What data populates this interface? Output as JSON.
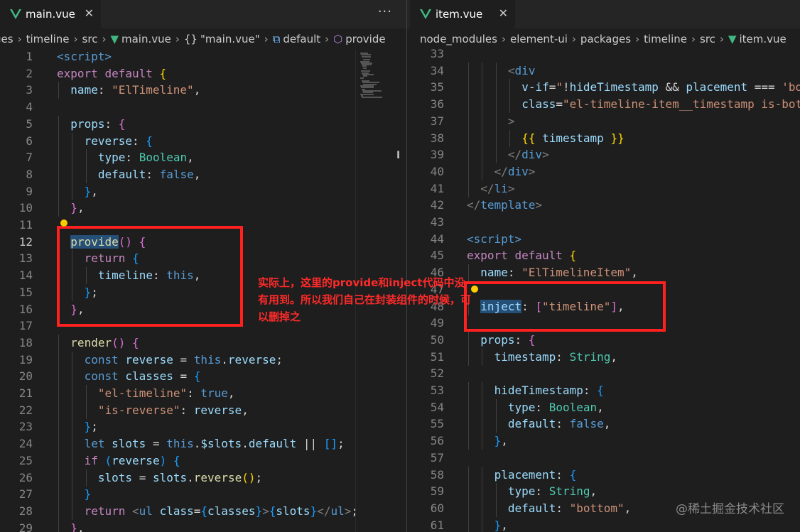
{
  "left": {
    "tab": {
      "title": "main.vue",
      "close": "✕"
    },
    "more": "···",
    "breadcrumb": [
      {
        "text": "ges",
        "icon": ""
      },
      {
        "text": "timeline",
        "icon": ""
      },
      {
        "text": "src",
        "icon": ""
      },
      {
        "text": "main.vue",
        "icon": "vue-icon"
      },
      {
        "text": "\"main.vue\"",
        "icon": "braces-icon"
      },
      {
        "text": "default",
        "icon": "module-icon"
      },
      {
        "text": "provide",
        "icon": "cube-icon"
      }
    ],
    "active_line": 12,
    "lines": [
      {
        "n": 1,
        "indent": 0,
        "tokens": [
          [
            "tag",
            "<script>"
          ]
        ]
      },
      {
        "n": 2,
        "indent": 0,
        "tokens": [
          [
            "ctl",
            "export"
          ],
          [
            "plain",
            " "
          ],
          [
            "ctl",
            "default"
          ],
          [
            "plain",
            " "
          ],
          [
            "b1",
            "{"
          ]
        ]
      },
      {
        "n": 3,
        "indent": 1,
        "tokens": [
          [
            "p",
            "name"
          ],
          [
            "plain",
            ": "
          ],
          [
            "s",
            "\"ElTimeline\""
          ],
          [
            "plain",
            ","
          ]
        ]
      },
      {
        "n": 4,
        "indent": 0,
        "tokens": []
      },
      {
        "n": 5,
        "indent": 1,
        "tokens": [
          [
            "p",
            "props"
          ],
          [
            "plain",
            ": "
          ],
          [
            "b2",
            "{"
          ]
        ]
      },
      {
        "n": 6,
        "indent": 2,
        "tokens": [
          [
            "p",
            "reverse"
          ],
          [
            "plain",
            ": "
          ],
          [
            "b3",
            "{"
          ]
        ]
      },
      {
        "n": 7,
        "indent": 3,
        "tokens": [
          [
            "p",
            "type"
          ],
          [
            "plain",
            ": "
          ],
          [
            "t",
            "Boolean"
          ],
          [
            "plain",
            ","
          ]
        ]
      },
      {
        "n": 8,
        "indent": 3,
        "tokens": [
          [
            "p",
            "default"
          ],
          [
            "plain",
            ": "
          ],
          [
            "k",
            "false"
          ],
          [
            "plain",
            ","
          ]
        ]
      },
      {
        "n": 9,
        "indent": 2,
        "tokens": [
          [
            "b3",
            "}"
          ],
          [
            "plain",
            ","
          ]
        ]
      },
      {
        "n": 10,
        "indent": 1,
        "tokens": [
          [
            "b2",
            "}"
          ],
          [
            "plain",
            ","
          ]
        ]
      },
      {
        "n": 11,
        "indent": 0,
        "tokens": []
      },
      {
        "n": 12,
        "indent": 1,
        "tokens": [
          [
            "f hl",
            "provide"
          ],
          [
            "b2",
            "()"
          ],
          [
            "plain",
            " "
          ],
          [
            "b2",
            "{"
          ]
        ]
      },
      {
        "n": 13,
        "indent": 2,
        "tokens": [
          [
            "ctl",
            "return"
          ],
          [
            "plain",
            " "
          ],
          [
            "b3",
            "{"
          ]
        ]
      },
      {
        "n": 14,
        "indent": 3,
        "tokens": [
          [
            "p",
            "timeline"
          ],
          [
            "plain",
            ": "
          ],
          [
            "k",
            "this"
          ],
          [
            "plain",
            ","
          ]
        ]
      },
      {
        "n": 15,
        "indent": 2,
        "tokens": [
          [
            "b3",
            "}"
          ],
          [
            "plain",
            ";"
          ]
        ]
      },
      {
        "n": 16,
        "indent": 1,
        "tokens": [
          [
            "b2",
            "}"
          ],
          [
            "plain",
            ","
          ]
        ]
      },
      {
        "n": 17,
        "indent": 0,
        "tokens": []
      },
      {
        "n": 18,
        "indent": 1,
        "tokens": [
          [
            "f",
            "render"
          ],
          [
            "b2",
            "()"
          ],
          [
            "plain",
            " "
          ],
          [
            "b2",
            "{"
          ]
        ]
      },
      {
        "n": 19,
        "indent": 2,
        "tokens": [
          [
            "k",
            "const"
          ],
          [
            "plain",
            " "
          ],
          [
            "p",
            "reverse"
          ],
          [
            "plain",
            " = "
          ],
          [
            "k",
            "this"
          ],
          [
            "plain",
            "."
          ],
          [
            "p",
            "reverse"
          ],
          [
            "plain",
            ";"
          ]
        ]
      },
      {
        "n": 20,
        "indent": 2,
        "tokens": [
          [
            "k",
            "const"
          ],
          [
            "plain",
            " "
          ],
          [
            "p",
            "classes"
          ],
          [
            "plain",
            " = "
          ],
          [
            "b3",
            "{"
          ]
        ]
      },
      {
        "n": 21,
        "indent": 3,
        "tokens": [
          [
            "s",
            "\"el-timeline\""
          ],
          [
            "plain",
            ": "
          ],
          [
            "k",
            "true"
          ],
          [
            "plain",
            ","
          ]
        ]
      },
      {
        "n": 22,
        "indent": 3,
        "tokens": [
          [
            "s",
            "\"is-reverse\""
          ],
          [
            "plain",
            ": "
          ],
          [
            "p",
            "reverse"
          ],
          [
            "plain",
            ","
          ]
        ]
      },
      {
        "n": 23,
        "indent": 2,
        "tokens": [
          [
            "b3",
            "}"
          ],
          [
            "plain",
            ";"
          ]
        ]
      },
      {
        "n": 24,
        "indent": 2,
        "tokens": [
          [
            "k",
            "let"
          ],
          [
            "plain",
            " "
          ],
          [
            "p",
            "slots"
          ],
          [
            "plain",
            " = "
          ],
          [
            "k",
            "this"
          ],
          [
            "plain",
            "."
          ],
          [
            "p",
            "$slots"
          ],
          [
            "plain",
            "."
          ],
          [
            "p",
            "default"
          ],
          [
            "plain",
            " || "
          ],
          [
            "b3",
            "[]"
          ],
          [
            "plain",
            ";"
          ]
        ]
      },
      {
        "n": 25,
        "indent": 2,
        "tokens": [
          [
            "ctl",
            "if"
          ],
          [
            "plain",
            " "
          ],
          [
            "b3",
            "("
          ],
          [
            "p",
            "reverse"
          ],
          [
            "b3",
            ")"
          ],
          [
            "plain",
            " "
          ],
          [
            "b3",
            "{"
          ]
        ]
      },
      {
        "n": 26,
        "indent": 3,
        "tokens": [
          [
            "p",
            "slots"
          ],
          [
            "plain",
            " = "
          ],
          [
            "p",
            "slots"
          ],
          [
            "plain",
            "."
          ],
          [
            "f",
            "reverse"
          ],
          [
            "b1",
            "()"
          ],
          [
            "plain",
            ";"
          ]
        ]
      },
      {
        "n": 27,
        "indent": 2,
        "tokens": [
          [
            "b3",
            "}"
          ]
        ]
      },
      {
        "n": 28,
        "indent": 2,
        "tokens": [
          [
            "ctl",
            "return"
          ],
          [
            "plain",
            " "
          ],
          [
            "gray",
            "<"
          ],
          [
            "tag",
            "ul"
          ],
          [
            "plain",
            " "
          ],
          [
            "p",
            "class"
          ],
          [
            "plain",
            "="
          ],
          [
            "b3",
            "{"
          ],
          [
            "p",
            "classes"
          ],
          [
            "b3",
            "}"
          ],
          [
            "gray",
            ">"
          ],
          [
            "b3",
            "{"
          ],
          [
            "p",
            "slots"
          ],
          [
            "b3",
            "}"
          ],
          [
            "gray",
            "</"
          ],
          [
            "tag",
            "ul"
          ],
          [
            "gray",
            ">"
          ],
          [
            "plain",
            ";"
          ]
        ]
      },
      {
        "n": 29,
        "indent": 1,
        "tokens": [
          [
            "b2",
            "}"
          ],
          [
            "plain",
            ","
          ]
        ]
      }
    ]
  },
  "right": {
    "tab": {
      "title": "item.vue",
      "close": "✕"
    },
    "breadcrumb": [
      {
        "text": "node_modules",
        "icon": ""
      },
      {
        "text": "element-ui",
        "icon": ""
      },
      {
        "text": "packages",
        "icon": ""
      },
      {
        "text": "timeline",
        "icon": ""
      },
      {
        "text": "src",
        "icon": ""
      },
      {
        "text": "item.vue",
        "icon": "vue-icon"
      }
    ],
    "lines": [
      {
        "n": 33,
        "indent": 0,
        "tokens": []
      },
      {
        "n": 34,
        "indent": 3,
        "tokens": [
          [
            "gray",
            "<"
          ],
          [
            "tag",
            "div"
          ]
        ]
      },
      {
        "n": 35,
        "indent": 4,
        "tokens": [
          [
            "p",
            "v-if"
          ],
          [
            "plain",
            "="
          ],
          [
            "s",
            "\""
          ],
          [
            "plain",
            "!"
          ],
          [
            "p",
            "hideTimestamp"
          ],
          [
            "plain",
            " && "
          ],
          [
            "p",
            "placement"
          ],
          [
            "plain",
            " === "
          ],
          [
            "s",
            "'bottom'\""
          ]
        ]
      },
      {
        "n": 36,
        "indent": 4,
        "tokens": [
          [
            "p",
            "class"
          ],
          [
            "plain",
            "="
          ],
          [
            "s",
            "\"el-timeline-item__timestamp is-bottom\""
          ]
        ]
      },
      {
        "n": 37,
        "indent": 3,
        "tokens": [
          [
            "gray",
            ">"
          ]
        ]
      },
      {
        "n": 38,
        "indent": 4,
        "tokens": [
          [
            "b1",
            "{{"
          ],
          [
            "plain",
            " "
          ],
          [
            "p",
            "timestamp"
          ],
          [
            "plain",
            " "
          ],
          [
            "b1",
            "}}"
          ]
        ]
      },
      {
        "n": 39,
        "indent": 3,
        "tokens": [
          [
            "gray",
            "</"
          ],
          [
            "tag",
            "div"
          ],
          [
            "gray",
            ">"
          ]
        ]
      },
      {
        "n": 40,
        "indent": 2,
        "tokens": [
          [
            "gray",
            "</"
          ],
          [
            "tag",
            "div"
          ],
          [
            "gray",
            ">"
          ]
        ]
      },
      {
        "n": 41,
        "indent": 1,
        "tokens": [
          [
            "gray",
            "</"
          ],
          [
            "tag",
            "li"
          ],
          [
            "gray",
            ">"
          ]
        ]
      },
      {
        "n": 42,
        "indent": 0,
        "tokens": [
          [
            "gray",
            "</"
          ],
          [
            "tag",
            "template"
          ],
          [
            "gray",
            ">"
          ]
        ]
      },
      {
        "n": 43,
        "indent": 0,
        "tokens": []
      },
      {
        "n": 44,
        "indent": 0,
        "tokens": [
          [
            "tag",
            "<script>"
          ]
        ]
      },
      {
        "n": 45,
        "indent": 0,
        "tokens": [
          [
            "ctl",
            "export"
          ],
          [
            "plain",
            " "
          ],
          [
            "ctl",
            "default"
          ],
          [
            "plain",
            " "
          ],
          [
            "b1",
            "{"
          ]
        ]
      },
      {
        "n": 46,
        "indent": 1,
        "tokens": [
          [
            "p",
            "name"
          ],
          [
            "plain",
            ": "
          ],
          [
            "s",
            "\"ElTimelineItem\""
          ],
          [
            "plain",
            ","
          ]
        ]
      },
      {
        "n": 47,
        "indent": 0,
        "tokens": []
      },
      {
        "n": 48,
        "indent": 1,
        "tokens": [
          [
            "p hl",
            "inject"
          ],
          [
            "plain",
            ": "
          ],
          [
            "b2",
            "["
          ],
          [
            "s",
            "\"timeline\""
          ],
          [
            "b2",
            "]"
          ],
          [
            "plain",
            ","
          ]
        ]
      },
      {
        "n": 49,
        "indent": 0,
        "tokens": []
      },
      {
        "n": 50,
        "indent": 1,
        "tokens": [
          [
            "p",
            "props"
          ],
          [
            "plain",
            ": "
          ],
          [
            "b2",
            "{"
          ]
        ]
      },
      {
        "n": 51,
        "indent": 2,
        "tokens": [
          [
            "p",
            "timestamp"
          ],
          [
            "plain",
            ": "
          ],
          [
            "t",
            "String"
          ],
          [
            "plain",
            ","
          ]
        ]
      },
      {
        "n": 52,
        "indent": 0,
        "tokens": []
      },
      {
        "n": 53,
        "indent": 2,
        "tokens": [
          [
            "p",
            "hideTimestamp"
          ],
          [
            "plain",
            ": "
          ],
          [
            "b3",
            "{"
          ]
        ]
      },
      {
        "n": 54,
        "indent": 3,
        "tokens": [
          [
            "p",
            "type"
          ],
          [
            "plain",
            ": "
          ],
          [
            "t",
            "Boolean"
          ],
          [
            "plain",
            ","
          ]
        ]
      },
      {
        "n": 55,
        "indent": 3,
        "tokens": [
          [
            "p",
            "default"
          ],
          [
            "plain",
            ": "
          ],
          [
            "k",
            "false"
          ],
          [
            "plain",
            ","
          ]
        ]
      },
      {
        "n": 56,
        "indent": 2,
        "tokens": [
          [
            "b3",
            "}"
          ],
          [
            "plain",
            ","
          ]
        ]
      },
      {
        "n": 57,
        "indent": 0,
        "tokens": []
      },
      {
        "n": 58,
        "indent": 2,
        "tokens": [
          [
            "p",
            "placement"
          ],
          [
            "plain",
            ": "
          ],
          [
            "b3",
            "{"
          ]
        ]
      },
      {
        "n": 59,
        "indent": 3,
        "tokens": [
          [
            "p",
            "type"
          ],
          [
            "plain",
            ": "
          ],
          [
            "t",
            "String"
          ],
          [
            "plain",
            ","
          ]
        ]
      },
      {
        "n": 60,
        "indent": 3,
        "tokens": [
          [
            "p",
            "default"
          ],
          [
            "plain",
            ": "
          ],
          [
            "s",
            "\"bottom\""
          ],
          [
            "plain",
            ","
          ]
        ]
      },
      {
        "n": 61,
        "indent": 2,
        "tokens": [
          [
            "b3",
            "}"
          ],
          [
            "plain",
            ","
          ]
        ]
      }
    ]
  },
  "annotation": "实际上，这里的provide和inject代码中没有用到。所以我们自己在封装组件的时候，可以删掉之",
  "watermark": "@稀土掘金技术社区",
  "colors": {
    "editor_bg": "#1e1e1e",
    "red_box": "#ff2020",
    "annotation": "#ff2a2a"
  }
}
